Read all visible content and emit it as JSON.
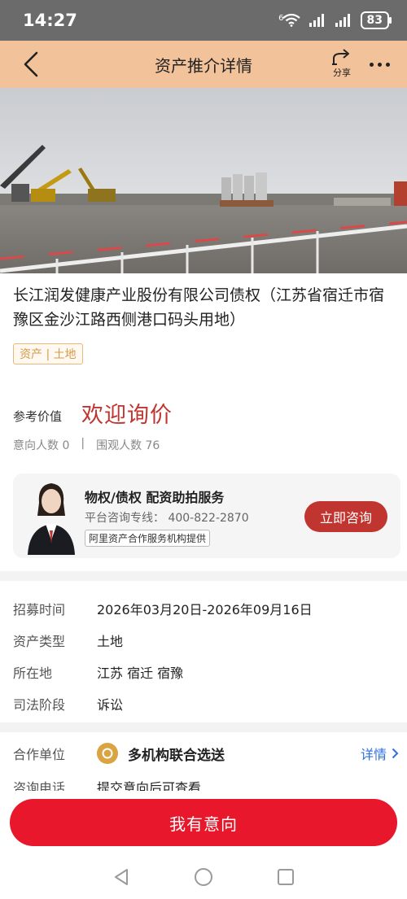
{
  "status_bar": {
    "time": "14:27",
    "network": "6",
    "battery": "83"
  },
  "nav": {
    "title": "资产推介详情",
    "share_label": "分享"
  },
  "asset": {
    "title": "长江润发健康产业股份有限公司债权（江苏省宿迁市宿豫区金沙江路西侧港口码头用地）",
    "tag": "资产 | 土地",
    "price_label": "参考价值",
    "price_value": "欢迎询价",
    "interest_count": "意向人数 0",
    "separator": "|",
    "view_count": "围观人数 76"
  },
  "service": {
    "title": "物权/债权   配资助拍服务",
    "hotline": "平台咨询专线： 400-822-2870",
    "provider": "阿里资产合作服务机构提供",
    "button": "立即咨询"
  },
  "info": [
    {
      "key": "招募时间",
      "value": "2026年03月20日-2026年09月16日"
    },
    {
      "key": "资产类型",
      "value": "土地"
    },
    {
      "key": "所在地",
      "value": "江苏 宿迁 宿豫"
    },
    {
      "key": "司法阶段",
      "value": "诉讼"
    }
  ],
  "coop": {
    "key": "合作单位",
    "value": "多机构联合选送",
    "detail": "详情"
  },
  "consult": {
    "key": "咨询电话",
    "value": "提交意向后可查看"
  },
  "cta": "我有意向",
  "colors": {
    "nav_bg": "#f2c29b",
    "accent_red": "#c0352f",
    "cta_red": "#e8172c",
    "link_blue": "#2f6fe0",
    "tag_gold": "#d39b4a"
  }
}
